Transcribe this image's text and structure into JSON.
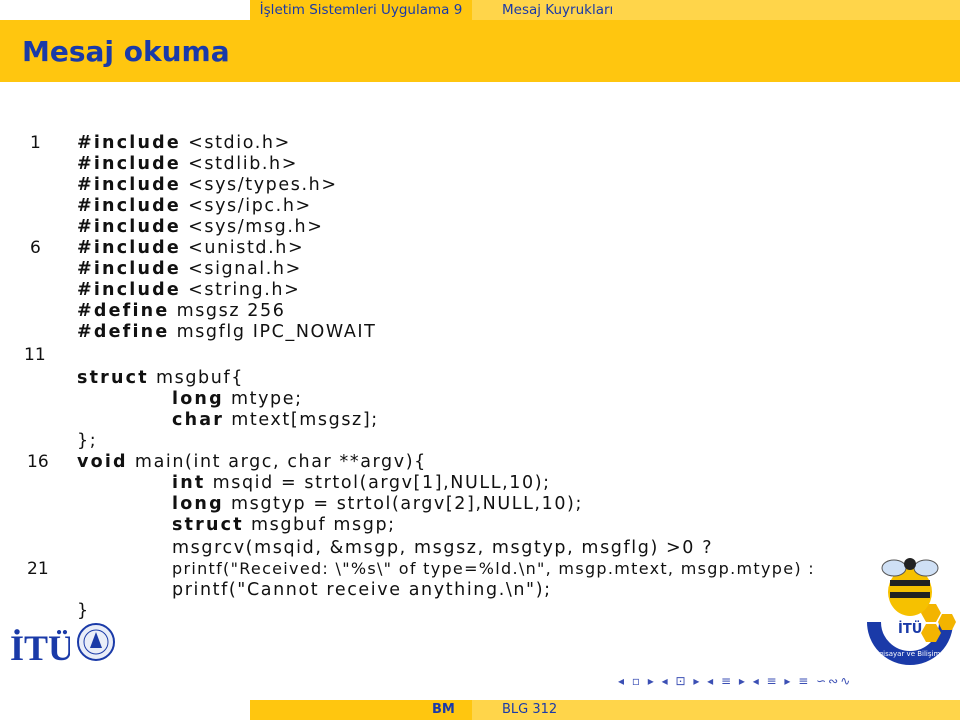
{
  "header": {
    "course": "İşletim Sistemleri Uygulama 9",
    "topic": "Mesaj Kuyrukları"
  },
  "frame": {
    "title": "Mesaj okuma"
  },
  "code": {
    "line_numbers": [
      "1",
      "6",
      "11",
      "16",
      "21"
    ],
    "lines": [
      "#include <stdio.h>",
      "#include <stdlib.h>",
      "#include <sys/types.h>",
      "#include <sys/ipc.h>",
      "#include <sys/msg.h>",
      "#include <unistd.h>",
      "#include <signal.h>",
      "#include <string.h>",
      "#define msgsz 256",
      "#define msgflg IPC_NOWAIT",
      "",
      "struct msgbuf{",
      "long mtype;",
      "char mtext[msgsz];",
      "};",
      "void main(int argc, char **argv){",
      "int msqid = strtol(argv[1],NULL,10);",
      "long msgtyp = strtol(argv[2],NULL,10);",
      "struct msgbuf msgp;",
      "msgrcv(msqid, &msgp, msgsz, msgtyp, msgflg) >0 ?",
      "printf(\"Received: \\\"%s\\\" of type=%ld.\\n\", msgp.mtext, msgp.mtype) :",
      "printf(\"Cannot receive anything.\\n\");",
      "}"
    ]
  },
  "logos": {
    "left_logo_text": "İTÜ",
    "right_logo_text": "İTÜ",
    "right_logo_ring": "Bilgisayar ve Bilişim Fakültesi"
  },
  "nav": {
    "symbols": "◂ ▫ ▸ ◂ ⊡ ▸ ◂ ≡ ▸ ◂ ≡ ▸ ≡ ∽∾∿"
  },
  "footer": {
    "left": "BM",
    "right": "BLG 312"
  },
  "colors": {
    "title_bar": "#ffc60f",
    "light_bar": "#ffd54a",
    "title_text": "#1a3aa8"
  }
}
